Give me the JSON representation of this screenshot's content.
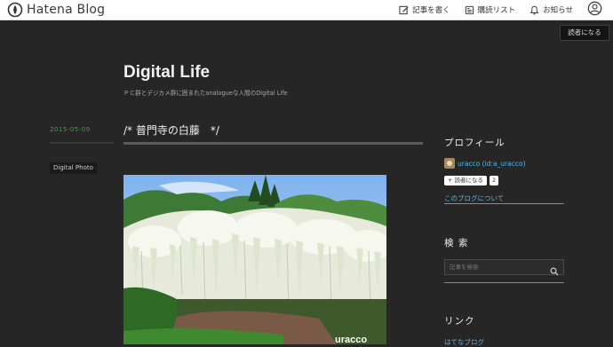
{
  "topbar": {
    "logo_text": "Hatena Blog",
    "write_label": "記事を書く",
    "reading_list_label": "購読リスト",
    "notifications_label": "お知らせ"
  },
  "subscribe_label": "読者になる",
  "blog": {
    "title": "Digital Life",
    "description": "ＰＣ群とデジカメ群に囲まれたanalogueな人間のDigital Life"
  },
  "entry": {
    "date": "2015-05-09",
    "title": "/* 普門寺の白藤　*/",
    "category": "Digital Photo"
  },
  "sidebar": {
    "profile_heading": "プロフィール",
    "profile_name": "uracco (id:a_uracco)",
    "follow_label": "+ 読者になる",
    "follow_count": "2",
    "about_link": "このブログについて",
    "search_heading": "検 索",
    "search_placeholder": "記事を検索",
    "links_heading": "リンク",
    "links_first": "はてなブログ"
  },
  "colors": {
    "background": "#262626",
    "link": "#58b7e6",
    "date": "#3f9f4f"
  }
}
